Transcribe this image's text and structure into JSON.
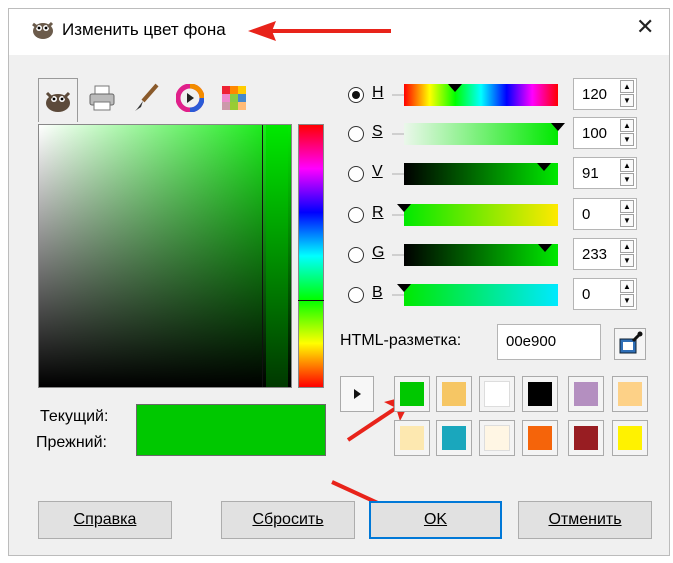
{
  "window": {
    "title": "Изменить цвет фона",
    "close_glyph": "✕",
    "app_icon": "gimp-icon"
  },
  "tabs": [
    {
      "name": "gimp-selector-tab",
      "icon": "gimp-icon",
      "active": true
    },
    {
      "name": "printer-tab",
      "icon": "printer-icon",
      "active": false
    },
    {
      "name": "brush-tab",
      "icon": "brush-icon",
      "active": false
    },
    {
      "name": "color-wheel-tab",
      "icon": "color-wheel-icon",
      "active": false
    },
    {
      "name": "palette-tab",
      "icon": "palette-icon",
      "active": false
    }
  ],
  "preview": {
    "current_label": "Текущий:",
    "previous_label": "Прежний:",
    "current_color": "#00c800",
    "previous_color": "#00c800"
  },
  "channels": [
    {
      "key": "H",
      "label": "H",
      "value": "120",
      "selected": true
    },
    {
      "key": "S",
      "label": "S",
      "value": "100",
      "selected": false
    },
    {
      "key": "V",
      "label": "V",
      "value": "91",
      "selected": false
    },
    {
      "key": "R",
      "label": "R",
      "value": "0",
      "selected": false
    },
    {
      "key": "G",
      "label": "G",
      "value": "233",
      "selected": false
    },
    {
      "key": "B",
      "label": "B",
      "value": "0",
      "selected": false
    }
  ],
  "html_notation": {
    "label": "HTML-разметка:",
    "value": "00e900"
  },
  "palette": {
    "history_colors": [
      "#00c800",
      "#f6c664",
      "#ffffff",
      "#000000",
      "#b48fc0",
      "#fdd187",
      "#fde8b0",
      "#1aa7bd",
      "#fff6e4",
      "#f5640a",
      "#981d22",
      "#fff200"
    ]
  },
  "buttons": {
    "help": "Справка",
    "reset": "Сбросить",
    "ok": "OK",
    "cancel": "Отменить"
  },
  "colors": {
    "selected_green": "#00e900",
    "annotation_red": "#e8231a",
    "focus_blue": "#0078d7"
  }
}
